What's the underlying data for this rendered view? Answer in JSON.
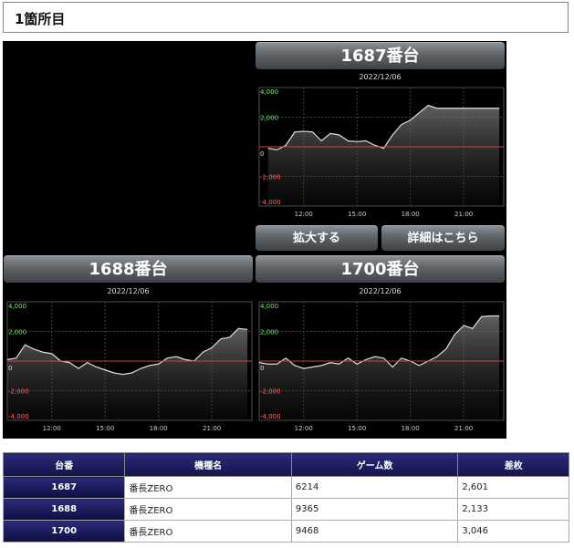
{
  "header": {
    "title": "1箇所目"
  },
  "buttons": {
    "zoom": "拡大する",
    "detail": "詳細はこちら"
  },
  "axis": {
    "y_ticks": [
      "4,000",
      "2,000",
      "0",
      "-2,000",
      "-4,000"
    ],
    "x_ticks": [
      "12:00",
      "15:00",
      "18:00",
      "21:00"
    ]
  },
  "colors": {
    "zero_line": "#d04040",
    "label_pos": "#66ff66",
    "label_neg": "#ff6666",
    "table_header": "#1a1a5e"
  },
  "chart_data": [
    {
      "type": "area",
      "title": "1687番台",
      "subtitle": "2022/12/06",
      "ylim": [
        -4000,
        4000
      ],
      "x": [
        10,
        10.5,
        11,
        11.5,
        12,
        12.5,
        13,
        13.5,
        14,
        14.5,
        15,
        15.5,
        16,
        16.5,
        17,
        17.5,
        18,
        18.5,
        19,
        19.5,
        20,
        20.5,
        21,
        21.5,
        22,
        22.5,
        23
      ],
      "values": [
        -100,
        -200,
        100,
        1000,
        1050,
        1000,
        400,
        900,
        800,
        400,
        350,
        400,
        100,
        -100,
        800,
        1500,
        1800,
        2300,
        2800,
        2601,
        2601,
        2601,
        2601,
        2601,
        2601,
        2601,
        2601
      ]
    },
    {
      "type": "area",
      "title": "1688番台",
      "subtitle": "2022/12/06",
      "ylim": [
        -4000,
        4000
      ],
      "x": [
        9.5,
        10,
        10.5,
        11,
        11.5,
        12,
        12.5,
        13,
        13.5,
        14,
        14.5,
        15,
        15.5,
        16,
        16.5,
        17,
        17.5,
        18,
        18.5,
        19,
        19.5,
        20,
        20.5,
        21,
        21.5,
        22,
        22.5,
        23
      ],
      "values": [
        100,
        200,
        1100,
        800,
        600,
        500,
        0,
        -100,
        -500,
        -100,
        -400,
        -600,
        -800,
        -900,
        -800,
        -500,
        -300,
        -200,
        200,
        300,
        100,
        0,
        600,
        900,
        1500,
        1600,
        2200,
        2133
      ]
    },
    {
      "type": "area",
      "title": "1700番台",
      "subtitle": "2022/12/06",
      "ylim": [
        -4000,
        4000
      ],
      "x": [
        9.5,
        10,
        10.5,
        11,
        11.5,
        12,
        12.5,
        13,
        13.5,
        14,
        14.5,
        15,
        15.5,
        16,
        16.5,
        17,
        17.5,
        18,
        18.5,
        19,
        19.5,
        20,
        20.5,
        21,
        21.5,
        22,
        22.5,
        23
      ],
      "values": [
        -100,
        -200,
        -200,
        200,
        -300,
        -500,
        -400,
        -300,
        -100,
        -200,
        200,
        -200,
        100,
        300,
        200,
        -400,
        200,
        0,
        -300,
        0,
        300,
        800,
        1800,
        2400,
        2200,
        3000,
        3046,
        3046
      ]
    }
  ],
  "table": {
    "headers": [
      "台番",
      "機種名",
      "ゲーム数",
      "差枚"
    ],
    "rows": [
      {
        "num": "1687",
        "name": "番長ZERO",
        "games": "6214",
        "diff": "2,601"
      },
      {
        "num": "1688",
        "name": "番長ZERO",
        "games": "9365",
        "diff": "2,133"
      },
      {
        "num": "1700",
        "name": "番長ZERO",
        "games": "9468",
        "diff": "3,046"
      }
    ]
  }
}
